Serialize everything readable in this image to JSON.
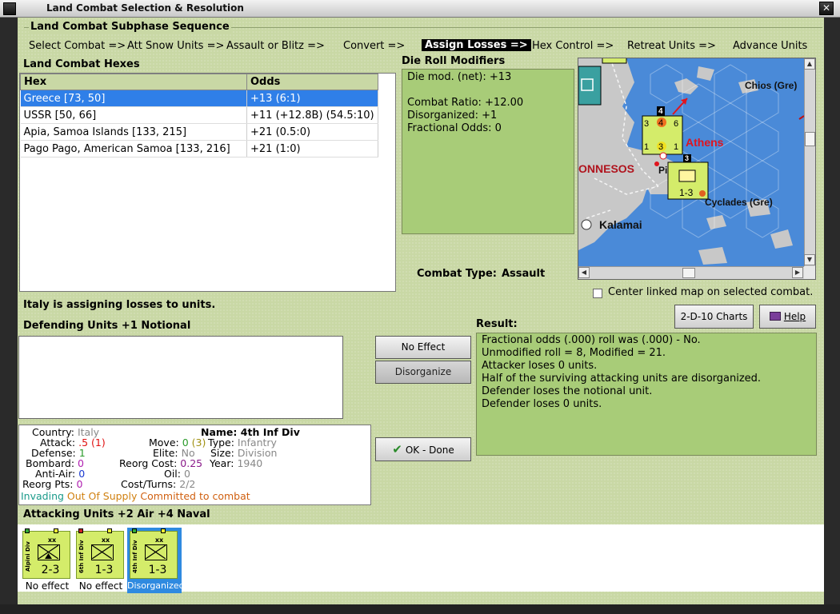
{
  "window": {
    "title": "Land Combat Selection & Resolution",
    "close_glyph": "✕"
  },
  "subphase": {
    "title": "Land Combat Subphase Sequence",
    "steps": [
      "Select Combat =>",
      "Att Snow Units =>",
      "Assault or Blitz =>",
      "Convert =>",
      "Assign Losses =>",
      "Hex Control =>",
      "Retreat Units =>",
      "Advance Units"
    ],
    "active_index": 4
  },
  "hexes": {
    "label": "Land Combat Hexes",
    "columns": [
      "Hex",
      "Odds"
    ],
    "rows": [
      {
        "hex": "Greece [73, 50]",
        "odds": "+13 (6:1)",
        "selected": true
      },
      {
        "hex": "USSR [50, 66]",
        "odds": "+11 (+12.8B) (54.5:10)",
        "selected": false
      },
      {
        "hex": "Apia, Samoa Islands [133, 215]",
        "odds": "+21 (0.5:0)",
        "selected": false
      },
      {
        "hex": "Pago Pago, American Samoa [133, 216]",
        "odds": "+21 (1:0)",
        "selected": false
      }
    ]
  },
  "die_roll": {
    "label": "Die Roll Modifiers",
    "lines": [
      "Die mod. (net): +13",
      "",
      "Combat Ratio: +12.00",
      "Disorganized: +1",
      "Fractional Odds: 0"
    ]
  },
  "map": {
    "places": [
      "Chios (Gre)",
      "Athens",
      "ONNESOS",
      "Kalamai",
      "Cyclades (Gre)",
      "Pi"
    ],
    "stack_value": "4",
    "unit_strength": "1-3",
    "stack_top": "3",
    "stack_left": "3",
    "stack_right": "6",
    "stack_mid": "4",
    "stack_bottom_left": "1",
    "stack_bottom_right": "1",
    "stack_bottom_mid": "3",
    "colors": {
      "sea": "#4a8ad8",
      "land": "#c9c9c9",
      "counter": "#d4ec6a",
      "red_text": "#e0141e"
    }
  },
  "combat_type": {
    "label": "Combat Type:",
    "value": "Assault"
  },
  "center_linked": {
    "label": "Center linked map on selected combat."
  },
  "buttons": {
    "charts": "2-D-10 Charts",
    "help": "Help",
    "no_effect": "No Effect",
    "disorganize": "Disorganize",
    "ok": "OK - Done"
  },
  "status_msg": "Italy is assigning losses to units.",
  "defending_label": "Defending Units +1 Notional",
  "result": {
    "label": "Result:",
    "lines": [
      "Fractional odds (.000) roll was (.000)  - No.",
      "Unmodified roll = 8, Modified = 21.",
      "Attacker loses 0 units.",
      "Half of the surviving attacking units are disorganized.",
      "Defender loses the notional unit.",
      "Defender loses 0 units."
    ]
  },
  "unit": {
    "country_label": "Country:",
    "country": "Italy",
    "name_label": "Name:",
    "name": "4th Inf Div",
    "attack_label": "Attack:",
    "attack": ".5",
    "attack_paren": "(1)",
    "move_label": "Move:",
    "move": "0",
    "move_paren": "(3)",
    "type_label": "Type:",
    "type": "Infantry",
    "defense_label": "Defense:",
    "defense": "1",
    "elite_label": "Elite:",
    "elite": "No",
    "size_label": "Size:",
    "size": "Division",
    "bombard_label": "Bombard:",
    "bombard": "0",
    "reorg_cost_label": "Reorg Cost:",
    "reorg_cost": "0.25",
    "year_label": "Year:",
    "year": "1940",
    "antiair_label": "Anti-Air:",
    "antiair": "0",
    "oil_label": "Oil:",
    "oil": "0",
    "reorg_pts_label": "Reorg Pts:",
    "reorg_pts": "0",
    "cost_turns_label": "Cost/Turns:",
    "cost_turns": "2/2",
    "flags": [
      "Invading",
      "Out Of Supply",
      "Committed to combat"
    ]
  },
  "attacking": {
    "label": "Attacking Units +2 Air +4 Naval",
    "units": [
      {
        "type": "Alpini Div",
        "size": "xx",
        "strength": "2-3",
        "status": "No effect",
        "selected": false
      },
      {
        "type": "6th Inf Div",
        "size": "xx",
        "strength": "1-3",
        "status": "No effect",
        "selected": false
      },
      {
        "type": "4th Inf Div",
        "size": "xx",
        "strength": "1-3",
        "status": "Disorganized",
        "selected": true
      }
    ]
  }
}
